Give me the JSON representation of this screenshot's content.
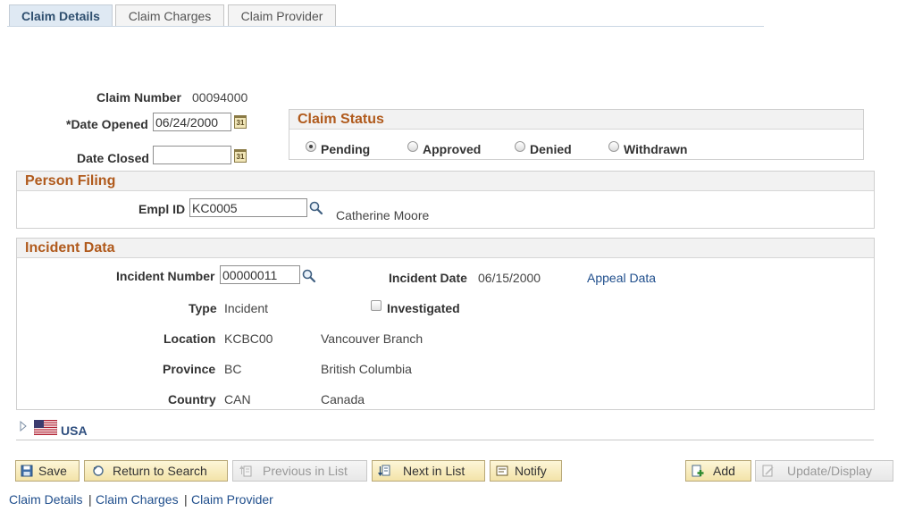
{
  "tabs": [
    {
      "label": "Claim Details",
      "active": true
    },
    {
      "label": "Claim Charges",
      "active": false
    },
    {
      "label": "Claim Provider",
      "active": false
    }
  ],
  "claim": {
    "number_label": "Claim Number",
    "number_value": "00094000",
    "date_opened_label": "*Date Opened",
    "date_opened_value": "06/24/2000",
    "date_closed_label": "Date Closed",
    "date_closed_value": ""
  },
  "claim_status": {
    "title": "Claim Status",
    "options": [
      "Pending",
      "Approved",
      "Denied",
      "Withdrawn"
    ],
    "selected": "Pending"
  },
  "person_filing": {
    "title": "Person Filing",
    "empl_id_label": "Empl ID",
    "empl_id_value": "KC0005",
    "name": "Catherine Moore"
  },
  "incident": {
    "title": "Incident Data",
    "number_label": "Incident Number",
    "number_value": "00000011",
    "date_label": "Incident Date",
    "date_value": "06/15/2000",
    "appeal_link": "Appeal Data",
    "type_label": "Type",
    "type_value": "Incident",
    "investigated_label": "Investigated",
    "location_label": "Location",
    "location_code": "KCBC00",
    "location_name": "Vancouver Branch",
    "province_label": "Province",
    "province_code": "BC",
    "province_name": "British Columbia",
    "country_label": "Country",
    "country_code": "CAN",
    "country_name": "Canada"
  },
  "usa_section": {
    "label": "USA"
  },
  "toolbar": {
    "save": "Save",
    "return_to_search": "Return to Search",
    "previous_in_list": "Previous in List",
    "next_in_list": "Next in List",
    "notify": "Notify",
    "add": "Add",
    "update_display": "Update/Display"
  },
  "footer_links": {
    "claim_details": "Claim Details",
    "claim_charges": "Claim Charges",
    "claim_provider": "Claim Provider",
    "separator": "|"
  },
  "colors": {
    "section_title": "#b05a1c",
    "link": "#1f4e8c",
    "tab_active_bg": "#dfe9f3"
  }
}
